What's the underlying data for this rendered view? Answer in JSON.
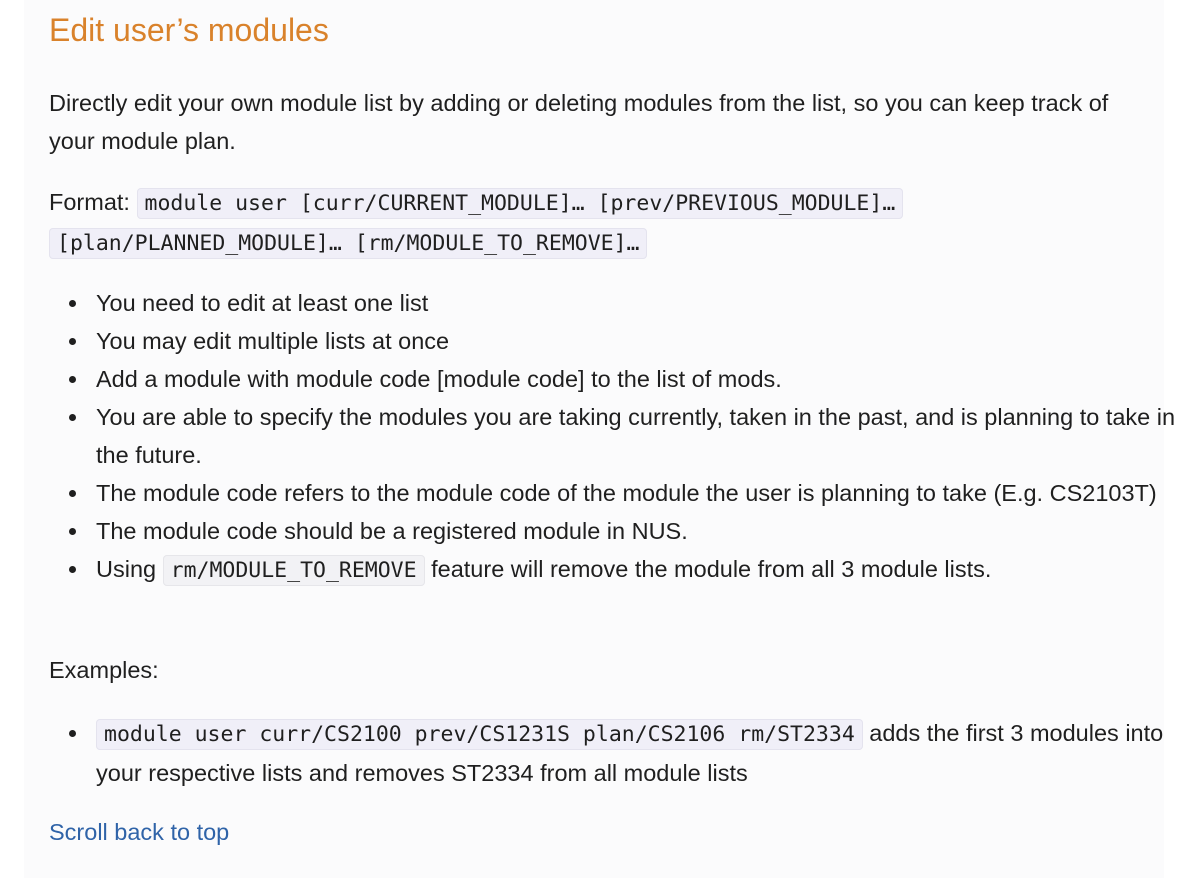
{
  "section": {
    "title": "Edit user’s modules",
    "description": "Directly edit your own module list by adding or deleting modules from the list, so you can keep track of your module plan."
  },
  "format": {
    "label": "Format:",
    "command": "module user [curr/CURRENT_MODULE]… [prev/PREVIOUS_MODULE]… [plan/PLANNED_MODULE]… [rm/MODULE_TO_REMOVE]…"
  },
  "notes": [
    "You need to edit at least one list",
    "You may edit multiple lists at once",
    "Add a module with module code [module code] to the list of mods.",
    "You are able to specify the modules you are taking currently, taken in the past, and is planning to take in the future.",
    "The module code refers to the module code of the module the user is planning to take (E.g. CS2103T)",
    "The module code should be a registered module in NUS."
  ],
  "rm_note": {
    "prefix": "Using",
    "code": "rm/MODULE_TO_REMOVE",
    "suffix": "feature will remove the module from all 3 module lists."
  },
  "examples": {
    "label": "Examples:",
    "items": [
      {
        "code": "module user curr/CS2100 prev/CS1231S plan/CS2106 rm/ST2334",
        "text": "adds the first 3 modules into your respective lists and removes ST2334 from all module lists"
      }
    ]
  },
  "footer": {
    "scroll_top_label": "Scroll back to top"
  }
}
